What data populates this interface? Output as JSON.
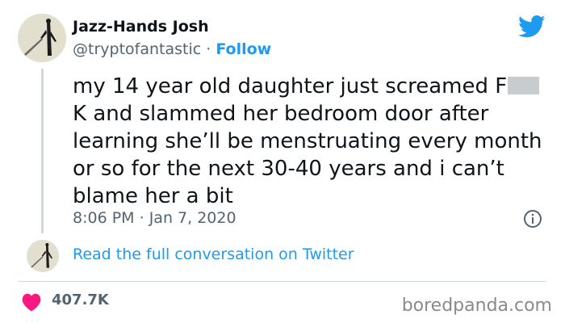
{
  "author": {
    "name": "Jazz-Hands Josh",
    "handle": "@tryptofantastic",
    "separator": "·",
    "follow_label": "Follow"
  },
  "tweet": {
    "text_before": "my 14 year old daughter just screamed F",
    "text_after": "K and slammed her bedroom door after learning she’ll be menstruating every month or so for the next 30-40 years and i can’t blame her a bit",
    "time": "8:06 PM",
    "date_separator": "·",
    "date": "Jan 7, 2020"
  },
  "conversation_link": "Read the full conversation on Twitter",
  "likes": "407.7K",
  "watermark": "boredpanda.com",
  "colors": {
    "accent": "#1d9bf0",
    "heart": "#f91880",
    "text": "#0f1419",
    "muted": "#536471"
  },
  "icons": [
    "twitter-bird-icon",
    "info-icon",
    "heart-icon"
  ]
}
